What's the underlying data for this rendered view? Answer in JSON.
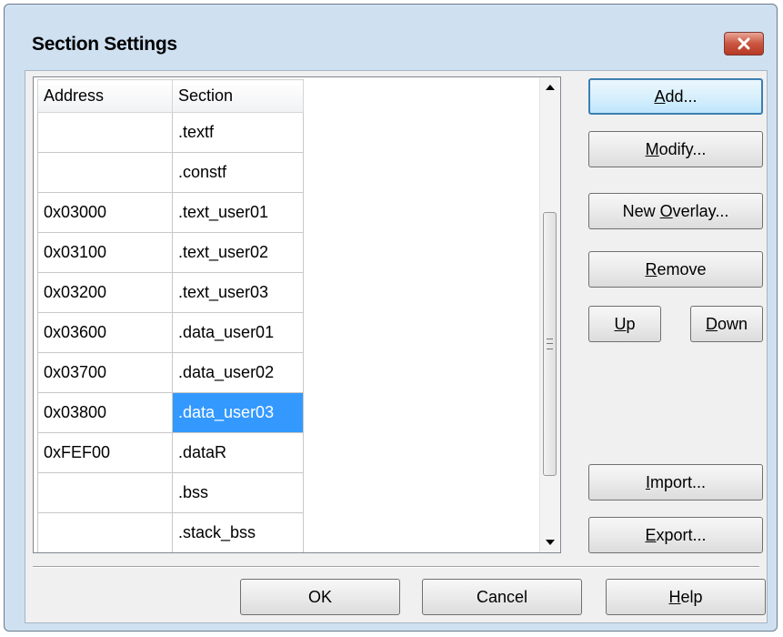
{
  "dialog": {
    "title": "Section Settings"
  },
  "grid": {
    "columns": [
      "Address",
      "Section"
    ],
    "rows": [
      {
        "address": "",
        "section": ".textf"
      },
      {
        "address": "",
        "section": ".constf"
      },
      {
        "address": "0x03000",
        "section": ".text_user01"
      },
      {
        "address": "0x03100",
        "section": ".text_user02"
      },
      {
        "address": "0x03200",
        "section": ".text_user03"
      },
      {
        "address": "0x03600",
        "section": ".data_user01"
      },
      {
        "address": "0x03700",
        "section": ".data_user02"
      },
      {
        "address": "0x03800",
        "section": ".data_user03",
        "selected": true
      },
      {
        "address": "0xFEF00",
        "section": ".dataR"
      },
      {
        "address": "",
        "section": ".bss"
      },
      {
        "address": "",
        "section": ".stack_bss"
      }
    ]
  },
  "buttons": {
    "add": {
      "label": "Add...",
      "mnemonic": "A"
    },
    "modify": {
      "label": "Modify...",
      "mnemonic": "M"
    },
    "new_overlay": {
      "label": "New Overlay...",
      "mnemonic": "O"
    },
    "remove": {
      "label": "Remove",
      "mnemonic": "R"
    },
    "up": {
      "label": "Up",
      "mnemonic": "U"
    },
    "down": {
      "label": "Down",
      "mnemonic": "D"
    },
    "import": {
      "label": "Import...",
      "mnemonic": "I"
    },
    "export": {
      "label": "Export...",
      "mnemonic": "E"
    },
    "ok": {
      "label": "OK"
    },
    "cancel": {
      "label": "Cancel"
    },
    "help": {
      "label": "Help",
      "mnemonic": "H"
    }
  },
  "colors": {
    "selection": "#3399ff",
    "close_button": "#c9553f",
    "window_frame": "#cfe0f1"
  }
}
